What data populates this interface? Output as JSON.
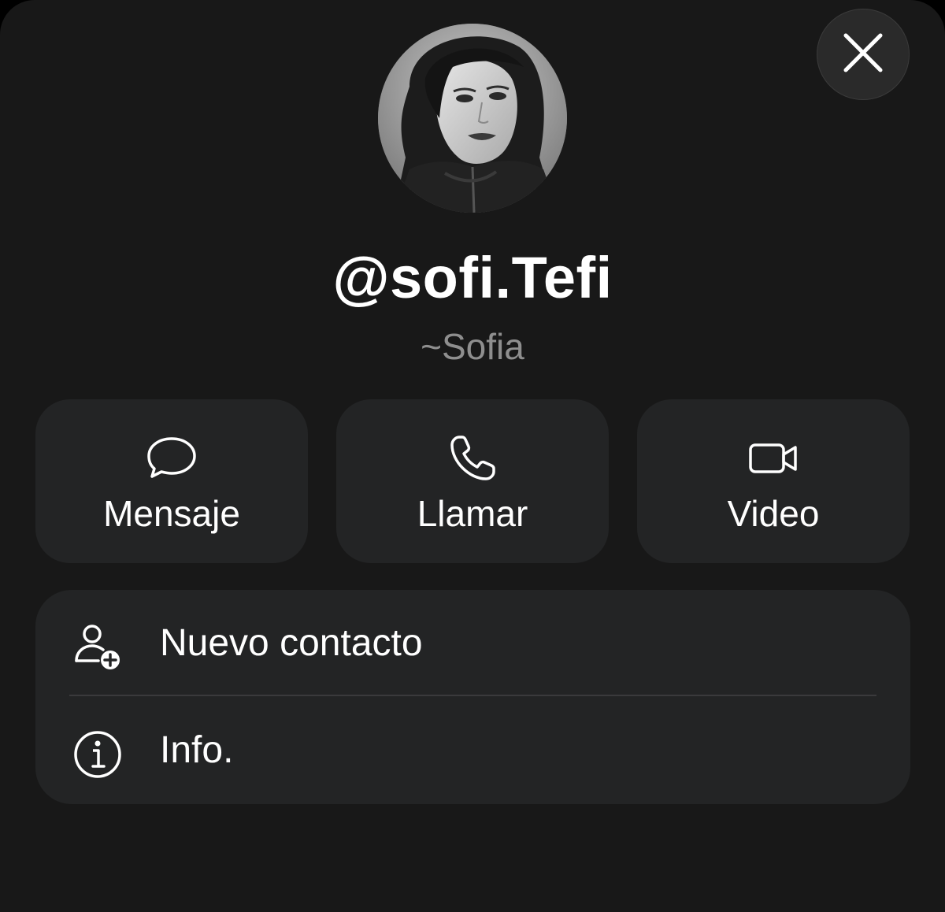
{
  "profile": {
    "username": "@sofi.Tefi",
    "display_name": "~Sofia",
    "avatar": "profile-photo"
  },
  "actions": [
    {
      "label": "Mensaje",
      "icon": "message-bubble-icon"
    },
    {
      "label": "Llamar",
      "icon": "phone-icon"
    },
    {
      "label": "Video",
      "icon": "video-camera-icon"
    }
  ],
  "list": [
    {
      "label": "Nuevo contacto",
      "icon": "add-contact-icon"
    },
    {
      "label": "Info.",
      "icon": "info-icon"
    }
  ],
  "close": {
    "icon": "close-icon"
  },
  "colors": {
    "background": "#181818",
    "card": "#232425",
    "text": "#ffffff",
    "secondary_text": "#8e8e8e",
    "divider": "#3a3a3c"
  }
}
